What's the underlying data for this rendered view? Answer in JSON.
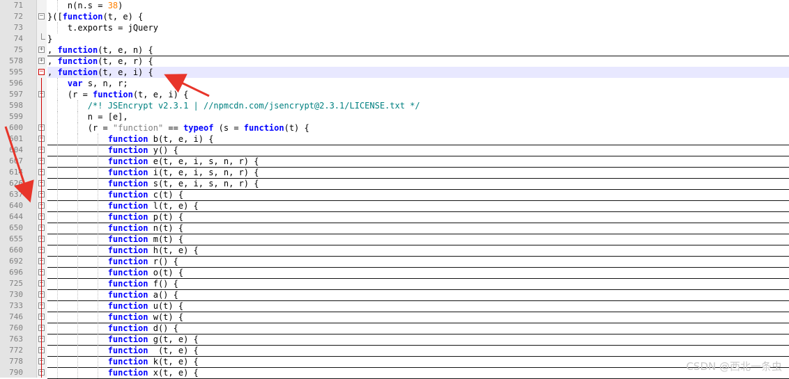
{
  "editor": {
    "lines": [
      {
        "num": "71",
        "indent": 2,
        "fold": "",
        "folded": false,
        "tokens": [
          {
            "t": "n(n.s = ",
            "c": "id"
          },
          {
            "t": "38",
            "c": "num"
          },
          {
            "t": ")",
            "c": "id"
          }
        ]
      },
      {
        "num": "72",
        "indent": 0,
        "fold": "minus",
        "folded": false,
        "tokens": [
          {
            "t": "}([",
            "c": "id"
          },
          {
            "t": "function",
            "c": "kw"
          },
          {
            "t": "(t, e) {",
            "c": "id"
          }
        ]
      },
      {
        "num": "73",
        "indent": 2,
        "fold": "",
        "folded": false,
        "tokens": [
          {
            "t": "t.exports = jQuery",
            "c": "id"
          }
        ]
      },
      {
        "num": "74",
        "indent": 0,
        "fold": "end",
        "folded": false,
        "tokens": [
          {
            "t": "}",
            "c": "id"
          }
        ]
      },
      {
        "num": "75",
        "indent": 0,
        "fold": "plus",
        "folded": true,
        "tokens": [
          {
            "t": ", ",
            "c": "id"
          },
          {
            "t": "function",
            "c": "kw"
          },
          {
            "t": "(t, e, n) {",
            "c": "id"
          }
        ]
      },
      {
        "num": "578",
        "indent": 0,
        "fold": "plus",
        "folded": true,
        "tokens": [
          {
            "t": ", ",
            "c": "id"
          },
          {
            "t": "function",
            "c": "kw"
          },
          {
            "t": "(t, e, r) {",
            "c": "id"
          }
        ]
      },
      {
        "num": "595",
        "indent": 0,
        "fold": "minus-red",
        "folded": false,
        "current": true,
        "tokens": [
          {
            "t": ", ",
            "c": "id"
          },
          {
            "t": "function",
            "c": "kw"
          },
          {
            "t": "(t, e, i) {",
            "c": "id"
          }
        ]
      },
      {
        "num": "596",
        "indent": 2,
        "fold": "",
        "folded": false,
        "tokens": [
          {
            "t": "var",
            "c": "kw"
          },
          {
            "t": " s, n, r;",
            "c": "id"
          }
        ]
      },
      {
        "num": "597",
        "indent": 2,
        "fold": "minus",
        "folded": false,
        "tokens": [
          {
            "t": "(r = ",
            "c": "id"
          },
          {
            "t": "function",
            "c": "kw"
          },
          {
            "t": "(t, e, i) {",
            "c": "id"
          }
        ]
      },
      {
        "num": "598",
        "indent": 4,
        "fold": "",
        "folded": false,
        "tokens": [
          {
            "t": "/*! JSEncrypt v2.3.1 | //npmcdn.com/jsencrypt@2.3.1/LICENSE.txt */",
            "c": "cm"
          }
        ]
      },
      {
        "num": "599",
        "indent": 4,
        "fold": "",
        "folded": false,
        "tokens": [
          {
            "t": "n = [e],",
            "c": "id"
          }
        ]
      },
      {
        "num": "600",
        "indent": 4,
        "fold": "minus",
        "folded": false,
        "tokens": [
          {
            "t": "(r = ",
            "c": "id"
          },
          {
            "t": "\"function\"",
            "c": "str"
          },
          {
            "t": " == ",
            "c": "id"
          },
          {
            "t": "typeof",
            "c": "kw"
          },
          {
            "t": " (s = ",
            "c": "id"
          },
          {
            "t": "function",
            "c": "kw"
          },
          {
            "t": "(t) {",
            "c": "id"
          }
        ]
      },
      {
        "num": "601",
        "indent": 6,
        "fold": "plus",
        "folded": true,
        "tokens": [
          {
            "t": "function",
            "c": "kw"
          },
          {
            "t": " b(t, e, i) {",
            "c": "id"
          }
        ]
      },
      {
        "num": "604",
        "indent": 6,
        "fold": "plus",
        "folded": true,
        "tokens": [
          {
            "t": "function",
            "c": "kw"
          },
          {
            "t": " y() {",
            "c": "id"
          }
        ]
      },
      {
        "num": "607",
        "indent": 6,
        "fold": "plus",
        "folded": true,
        "tokens": [
          {
            "t": "function",
            "c": "kw"
          },
          {
            "t": " e(t, e, i, s, n, r) {",
            "c": "id"
          }
        ]
      },
      {
        "num": "614",
        "indent": 6,
        "fold": "plus",
        "folded": true,
        "tokens": [
          {
            "t": "function",
            "c": "kw"
          },
          {
            "t": " i(t, e, i, s, n, r) {",
            "c": "id"
          }
        ]
      },
      {
        "num": "626",
        "indent": 6,
        "fold": "plus",
        "folded": true,
        "tokens": [
          {
            "t": "function",
            "c": "kw"
          },
          {
            "t": " s(t, e, i, s, n, r) {",
            "c": "id"
          }
        ]
      },
      {
        "num": "637",
        "indent": 6,
        "fold": "plus",
        "folded": true,
        "tokens": [
          {
            "t": "function",
            "c": "kw"
          },
          {
            "t": " c(t) {",
            "c": "id"
          }
        ]
      },
      {
        "num": "640",
        "indent": 6,
        "fold": "plus",
        "folded": true,
        "tokens": [
          {
            "t": "function",
            "c": "kw"
          },
          {
            "t": " l(t, e) {",
            "c": "id"
          }
        ]
      },
      {
        "num": "644",
        "indent": 6,
        "fold": "plus",
        "folded": true,
        "tokens": [
          {
            "t": "function",
            "c": "kw"
          },
          {
            "t": " p(t) {",
            "c": "id"
          }
        ]
      },
      {
        "num": "650",
        "indent": 6,
        "fold": "plus",
        "folded": true,
        "tokens": [
          {
            "t": "function",
            "c": "kw"
          },
          {
            "t": " n(t) {",
            "c": "id"
          }
        ]
      },
      {
        "num": "655",
        "indent": 6,
        "fold": "plus",
        "folded": true,
        "tokens": [
          {
            "t": "function",
            "c": "kw"
          },
          {
            "t": " m(t) {",
            "c": "id"
          }
        ]
      },
      {
        "num": "660",
        "indent": 6,
        "fold": "plus",
        "folded": true,
        "tokens": [
          {
            "t": "function",
            "c": "kw"
          },
          {
            "t": " h(t, e) {",
            "c": "id"
          }
        ]
      },
      {
        "num": "692",
        "indent": 6,
        "fold": "plus",
        "folded": true,
        "tokens": [
          {
            "t": "function",
            "c": "kw"
          },
          {
            "t": " r() {",
            "c": "id"
          }
        ]
      },
      {
        "num": "696",
        "indent": 6,
        "fold": "plus",
        "folded": true,
        "tokens": [
          {
            "t": "function",
            "c": "kw"
          },
          {
            "t": " o(t) {",
            "c": "id"
          }
        ]
      },
      {
        "num": "725",
        "indent": 6,
        "fold": "plus",
        "folded": true,
        "tokens": [
          {
            "t": "function",
            "c": "kw"
          },
          {
            "t": " f() {",
            "c": "id"
          }
        ]
      },
      {
        "num": "730",
        "indent": 6,
        "fold": "plus",
        "folded": true,
        "tokens": [
          {
            "t": "function",
            "c": "kw"
          },
          {
            "t": " a() {",
            "c": "id"
          }
        ]
      },
      {
        "num": "733",
        "indent": 6,
        "fold": "plus",
        "folded": true,
        "tokens": [
          {
            "t": "function",
            "c": "kw"
          },
          {
            "t": " u(t) {",
            "c": "id"
          }
        ]
      },
      {
        "num": "746",
        "indent": 6,
        "fold": "plus",
        "folded": true,
        "tokens": [
          {
            "t": "function",
            "c": "kw"
          },
          {
            "t": " w(t) {",
            "c": "id"
          }
        ]
      },
      {
        "num": "760",
        "indent": 6,
        "fold": "plus",
        "folded": true,
        "tokens": [
          {
            "t": "function",
            "c": "kw"
          },
          {
            "t": " d() {",
            "c": "id"
          }
        ]
      },
      {
        "num": "763",
        "indent": 6,
        "fold": "plus",
        "folded": true,
        "tokens": [
          {
            "t": "function",
            "c": "kw"
          },
          {
            "t": " g(t, e) {",
            "c": "id"
          }
        ]
      },
      {
        "num": "772",
        "indent": 6,
        "fold": "plus",
        "folded": true,
        "tokens": [
          {
            "t": "function",
            "c": "kw"
          },
          {
            "t": "  (t, e) {",
            "c": "id"
          }
        ]
      },
      {
        "num": "778",
        "indent": 6,
        "fold": "plus",
        "folded": true,
        "tokens": [
          {
            "t": "function",
            "c": "kw"
          },
          {
            "t": " k(t, e) {",
            "c": "id"
          }
        ]
      },
      {
        "num": "790",
        "indent": 6,
        "fold": "plus",
        "folded": true,
        "tokens": [
          {
            "t": "function",
            "c": "kw"
          },
          {
            "t": " x(t, e) {",
            "c": "id"
          }
        ]
      }
    ]
  },
  "colors": {
    "keyword": "#0000ff",
    "comment": "#008080",
    "number": "#ff8000",
    "string": "#808080",
    "highlight": "#e8e8ff",
    "annotation_arrow": "#e8352a",
    "fold_active": "#d00000"
  },
  "icons": {
    "fold_plus": "fold-expand-icon",
    "fold_minus": "fold-collapse-icon",
    "arrow": "annotation-arrow-icon"
  },
  "watermark": "CSDN @西北一条虫"
}
